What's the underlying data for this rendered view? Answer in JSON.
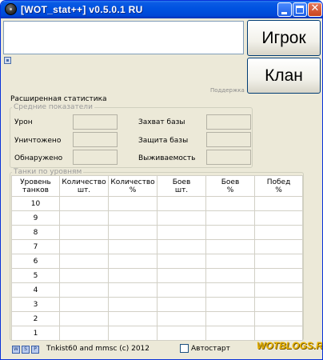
{
  "window": {
    "title": "[WOT_stat++] v0.5.0.1 RU",
    "title_bar_color": "#0054e3",
    "controls": {
      "minimize": "_",
      "maximize": "□",
      "close": "✕"
    }
  },
  "top": {
    "player_input_value": "",
    "player_button": "Игрок",
    "clan_button": "Клан",
    "support_link": "Поддержка"
  },
  "extended": {
    "title": "Расширенная статистика",
    "averages": {
      "title": "Средние показатели",
      "damage": {
        "label": "Урон",
        "value": ""
      },
      "destroyed": {
        "label": "Уничтожено",
        "value": ""
      },
      "detected": {
        "label": "Обнаружено",
        "value": ""
      },
      "base_capture": {
        "label": "Захват базы",
        "value": ""
      },
      "base_defense": {
        "label": "Защита базы",
        "value": ""
      },
      "survivability": {
        "label": "Выживаемость",
        "value": ""
      }
    },
    "levels": {
      "title": "Танки по уровням",
      "columns": [
        {
          "line1": "Уровень",
          "line2": "танков"
        },
        {
          "line1": "Количество",
          "line2": "шт."
        },
        {
          "line1": "Количество",
          "line2": "%"
        },
        {
          "line1": "Боев",
          "line2": "шт."
        },
        {
          "line1": "Боев",
          "line2": "%"
        },
        {
          "line1": "Побед",
          "line2": "%"
        }
      ],
      "rows": [
        "10",
        "9",
        "8",
        "7",
        "6",
        "5",
        "4",
        "3",
        "2",
        "1"
      ]
    }
  },
  "bottom": {
    "mini_buttons": [
      "W",
      "S",
      "P"
    ],
    "copyright": "Tnkist60 and mmsc (c) 2012",
    "autostart_label": "Автостарт",
    "autostart_checked": false,
    "watermark": "WOTBLOGS.RU"
  }
}
